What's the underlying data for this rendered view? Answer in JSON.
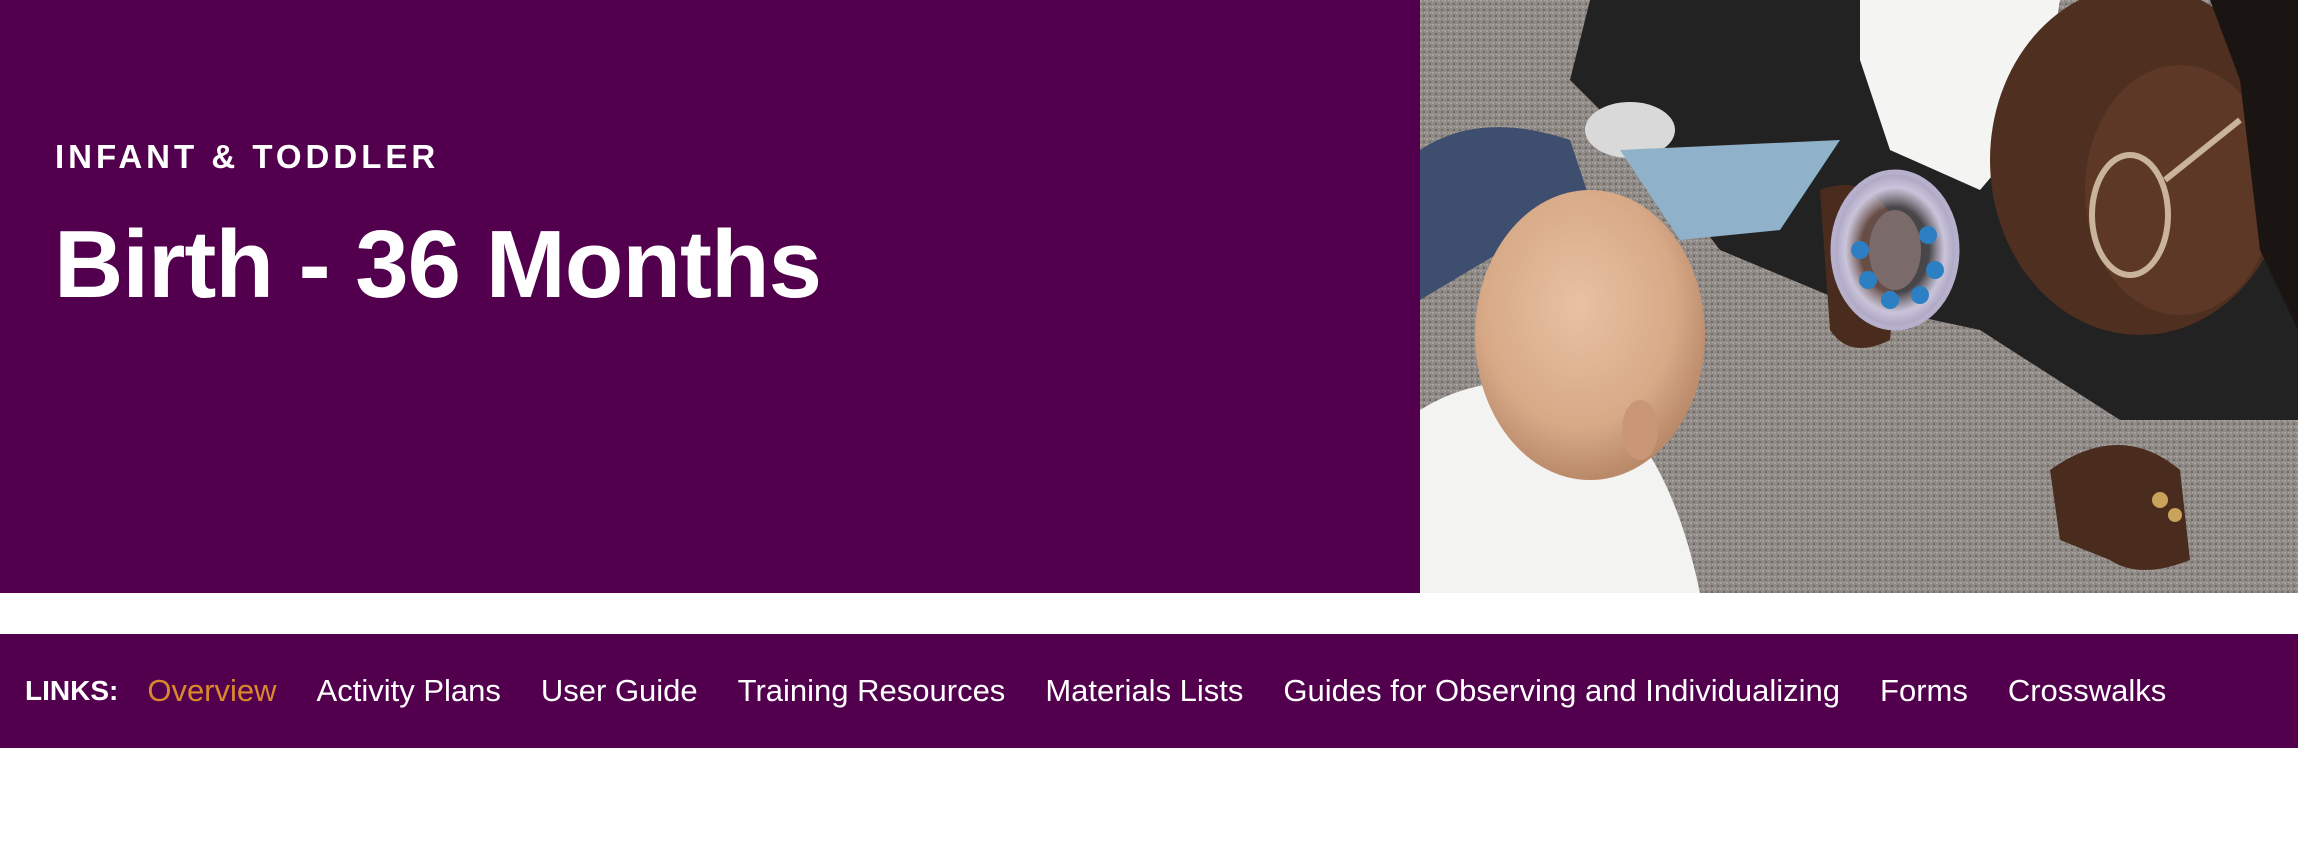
{
  "hero": {
    "eyebrow": "INFANT & TODDLER",
    "title": "Birth - 36 Months",
    "background_color": "#52004e",
    "photo_alt": "Caregiver lying on carpet showing a rattle toy to a baby"
  },
  "links": {
    "label": "LINKS:",
    "items": [
      {
        "label": "Overview",
        "active": true
      },
      {
        "label": "Activity Plans",
        "active": false
      },
      {
        "label": "User Guide",
        "active": false
      },
      {
        "label": "Training Resources",
        "active": false
      },
      {
        "label": "Materials Lists",
        "active": false
      },
      {
        "label": "Guides for Observing and Individualizing",
        "active": false
      },
      {
        "label": "Forms",
        "active": false
      },
      {
        "label": "Crosswalks",
        "active": false
      }
    ],
    "active_color": "#d9892b"
  }
}
